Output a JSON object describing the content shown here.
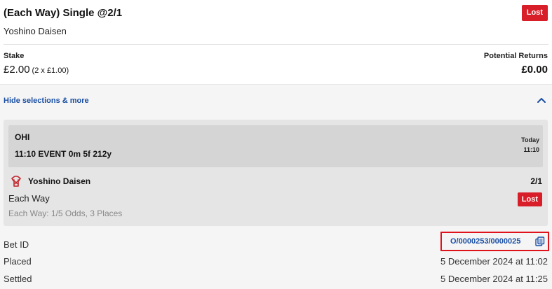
{
  "bet": {
    "title": "(Each Way) Single @2/1",
    "selection": "Yoshino Daisen",
    "status": "Lost"
  },
  "stake": {
    "label": "Stake",
    "value": "£2.00",
    "note": "(2 x £1.00)"
  },
  "returns": {
    "label": "Potential Returns",
    "value": "£0.00"
  },
  "toggle": {
    "label": "Hide selections & more"
  },
  "selection_card": {
    "event_code": "OHI",
    "event_name": "11:10 EVENT 0m 5f 212y",
    "day": "Today",
    "time": "11:10",
    "runner": "Yoshino Daisen",
    "odds": "2/1",
    "market": "Each Way",
    "terms": "Each Way: 1/5 Odds, 3 Places",
    "status": "Lost"
  },
  "details": {
    "bet_id_label": "Bet ID",
    "bet_id": "O/0000253/0000025",
    "placed_label": "Placed",
    "placed": "5 December 2024 at 11:02",
    "settled_label": "Settled",
    "settled": "5 December 2024 at 11:25"
  },
  "colors": {
    "lost_badge": "#d81e28",
    "link": "#1a4fa3",
    "highlight_border": "#e0121b"
  },
  "icons": {
    "collapse": "chevron-up-icon",
    "silk": "jockey-silk-icon",
    "copy": "copy-icon"
  }
}
